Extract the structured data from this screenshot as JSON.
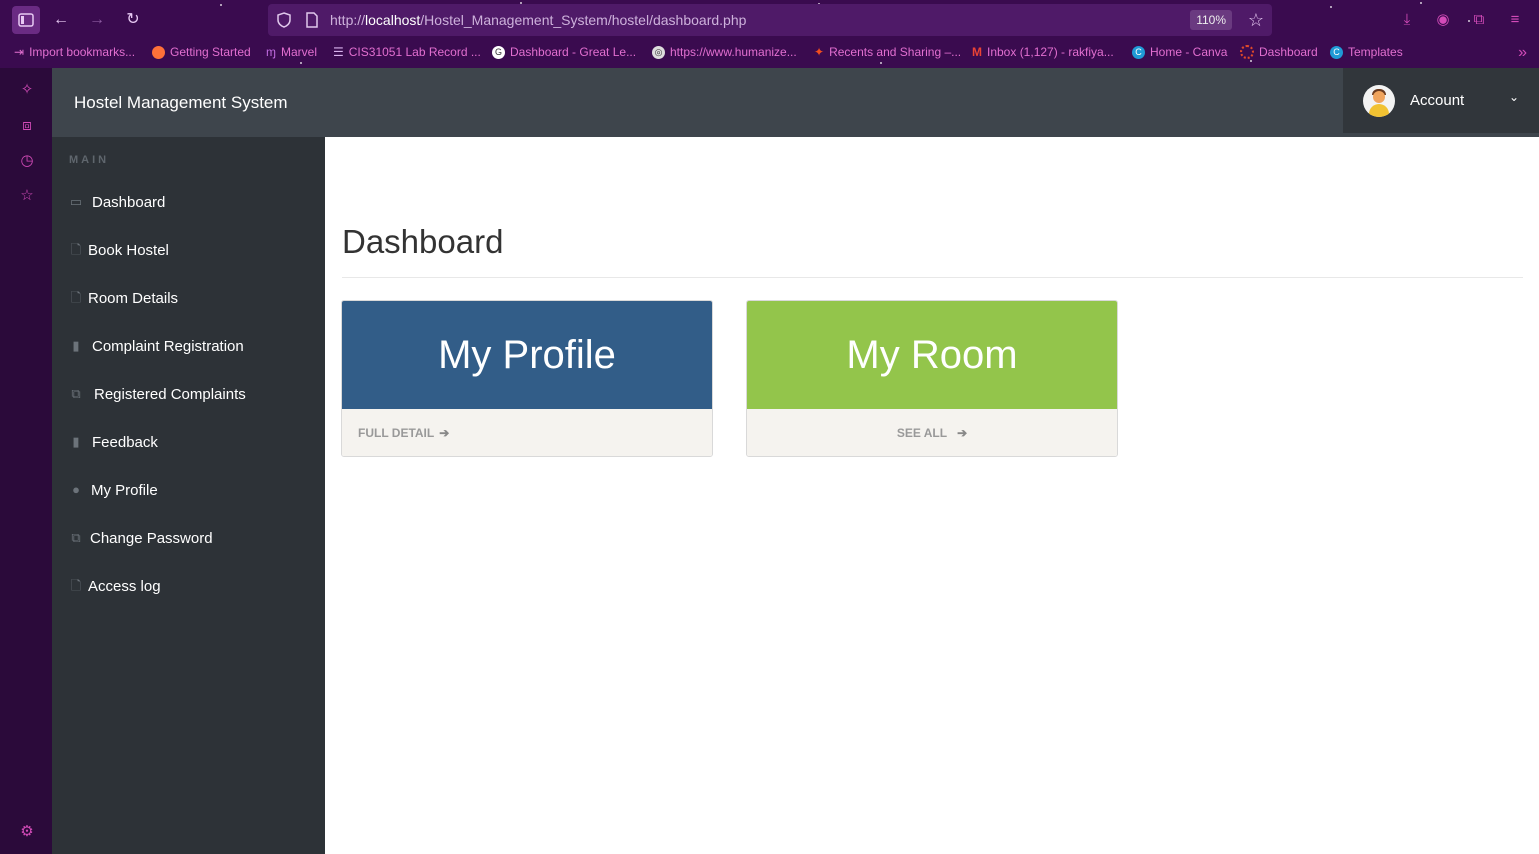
{
  "browser": {
    "url_prefix": "http://",
    "url_host": "localhost",
    "url_path": "/Hostel_Management_System/hostel/dashboard.php",
    "zoom": "110%",
    "bookmarks": [
      "Import bookmarks...",
      "Getting Started",
      "Marvel",
      "CIS31051 Lab Record ...",
      "Dashboard - Great Le...",
      "https://www.humanize...",
      "Recents and Sharing –...",
      "Inbox (1,127) - rakfiya...",
      "Home - Canva",
      "Dashboard",
      "Templates"
    ]
  },
  "header": {
    "brand": "Hostel Management System",
    "account_label": "Account"
  },
  "sidebar": {
    "heading": "MAIN",
    "items": [
      {
        "label": "Dashboard",
        "icon": "desktop-icon"
      },
      {
        "label": "Book Hostel",
        "icon": "file-icon"
      },
      {
        "label": "Room Details",
        "icon": "file-icon"
      },
      {
        "label": "Complaint Registration",
        "icon": "file-filled-icon"
      },
      {
        "label": "Registered Complaints",
        "icon": "files-icon"
      },
      {
        "label": "Feedback",
        "icon": "file-filled-icon"
      },
      {
        "label": "My Profile",
        "icon": "user-icon"
      },
      {
        "label": "Change Password",
        "icon": "files-icon"
      },
      {
        "label": "Access log",
        "icon": "file-icon"
      }
    ]
  },
  "main": {
    "title": "Dashboard",
    "cards": [
      {
        "title": "My Profile",
        "link": "FULL DETAIL",
        "color": "#325d88"
      },
      {
        "title": "My Room",
        "link": "SEE ALL",
        "color": "#93c54b"
      }
    ]
  }
}
